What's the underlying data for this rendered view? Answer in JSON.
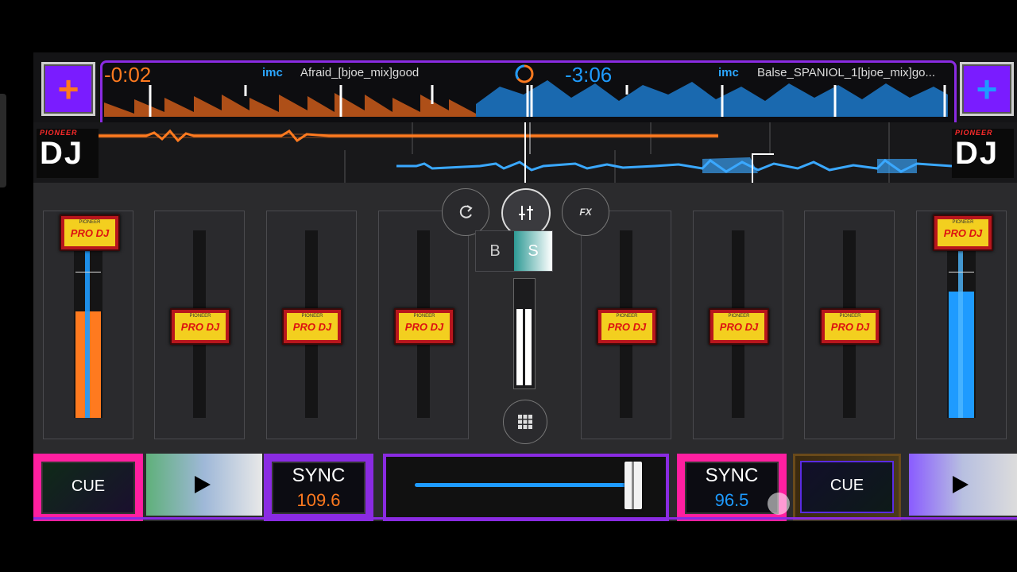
{
  "deck_a": {
    "time": "-0:02",
    "deck_id": "imc",
    "track": "Afraid_[bjoe_mix]good",
    "add_label": "+",
    "cue_label": "CUE",
    "sync_label": "SYNC",
    "bpm": "109.6",
    "color": "#ff7a1f"
  },
  "deck_b": {
    "time": "-3:06",
    "deck_id": "imc",
    "track": "Balse_SPANIOL_1[bjoe_mix]go...",
    "add_label": "+",
    "cue_label": "CUE",
    "sync_label": "SYNC",
    "bpm": "96.5",
    "color": "#1e9bff"
  },
  "logo": {
    "brand": "PIONEER",
    "mark": "DJ"
  },
  "knob": {
    "brand": "PIONEER",
    "mark": "PRO DJ"
  },
  "mixer": {
    "fx_label": "FX",
    "b_label": "B",
    "s_label": "S",
    "volume_a_level": 0.63,
    "volume_b_level": 0.75,
    "crossfader_position": 0.96
  },
  "colors": {
    "accent_purple": "#8a2be2",
    "accent_pink": "#ff1fa0",
    "orange": "#ff7a1f",
    "blue": "#1e9bff"
  }
}
